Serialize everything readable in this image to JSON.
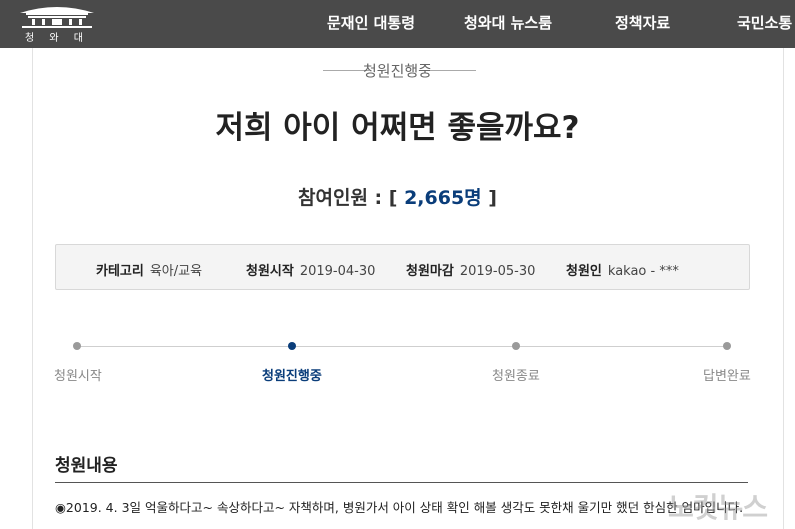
{
  "header": {
    "logo_text": "청 와 대",
    "nav": [
      {
        "label": "문재인 대통령"
      },
      {
        "label": "청와대 뉴스룸"
      },
      {
        "label": "정책자료"
      },
      {
        "label": "국민소통"
      }
    ]
  },
  "petition": {
    "status": "청원진행중",
    "title": "저희 아이 어쩌면 좋을까요?",
    "participants_label": "참여인원 : [",
    "participants_count": "2,665명",
    "participants_close": " ]",
    "info": {
      "category_label": "카테고리",
      "category_value": "육아/교육",
      "start_label": "청원시작",
      "start_value": "2019-04-30",
      "end_label": "청원마감",
      "end_value": "2019-05-30",
      "author_label": "청원인",
      "author_value": "kakao - ***"
    },
    "timeline": [
      {
        "label": "청원시작",
        "active": false
      },
      {
        "label": "청원진행중",
        "active": true
      },
      {
        "label": "청원종료",
        "active": false
      },
      {
        "label": "답변완료",
        "active": false
      }
    ],
    "content_title": "청원내용",
    "content_text": "◉2019. 4. 3일 억울하다고~ 속상하다고~ 자책하며, 병원가서 아이 상태 확인 해볼 생각도 못한채 울기만 했던 한심한 엄마입니다."
  },
  "watermark": "노컷뉴스",
  "colors": {
    "topbar": "#4a4a4a",
    "accent": "#0a3d7a",
    "info_bg": "#f4f4f4"
  }
}
